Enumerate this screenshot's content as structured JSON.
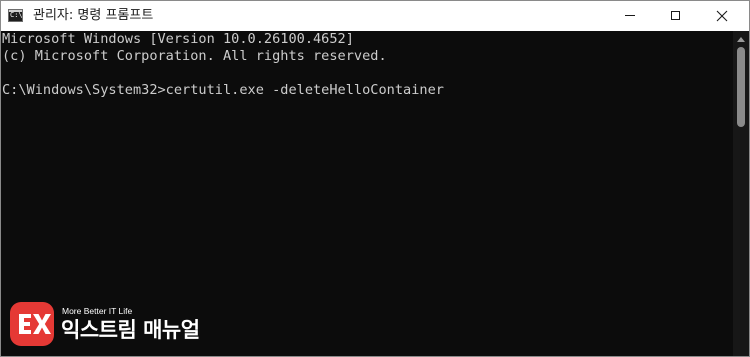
{
  "window": {
    "title": "관리자: 명령 프롬프트",
    "app_icon_text": "C:\\",
    "app_icon": "cmd-icon",
    "controls": {
      "minimize": "minimize-icon",
      "maximize": "maximize-icon",
      "close": "close-icon"
    }
  },
  "console": {
    "lines": [
      "Microsoft Windows [Version 10.0.26100.4652]",
      "(c) Microsoft Corporation. All rights reserved.",
      "",
      "C:\\Windows\\System32>certutil.exe -deleteHelloContainer"
    ]
  },
  "colors": {
    "console_background": "#0c0c0c",
    "console_text": "#cccccc",
    "titlebar_background": "#ffffff",
    "logo_badge": "#e53935"
  },
  "watermark": {
    "tagline": "More Better IT Life",
    "name": "익스트림 매뉴얼",
    "badge_icon": "ex-logo-icon"
  }
}
